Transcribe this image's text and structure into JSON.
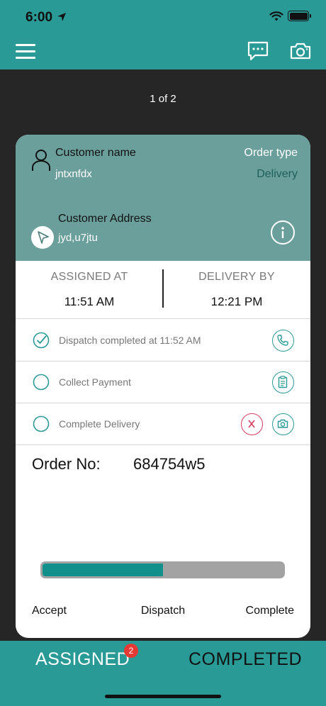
{
  "status_bar": {
    "time": "6:00"
  },
  "pager": "1 of 2",
  "customer": {
    "label": "Customer name",
    "name": "jntxnfdx"
  },
  "order_type": {
    "label": "Order type",
    "value": "Delivery"
  },
  "address": {
    "label": "Customer Address",
    "value": "jyd,u7jtu"
  },
  "times": {
    "assigned_label": "ASSIGNED AT",
    "assigned_value": "11:51 AM",
    "delivery_label": "DELIVERY BY",
    "delivery_value": "12:21 PM"
  },
  "tasks": [
    {
      "label": "Dispatch completed at 11:52 AM",
      "done": true,
      "actions": [
        "phone-icon"
      ]
    },
    {
      "label": "Collect Payment",
      "done": false,
      "actions": [
        "clipboard-icon"
      ]
    },
    {
      "label": "Complete Delivery",
      "done": false,
      "actions": [
        "close-icon",
        "camera-icon"
      ]
    }
  ],
  "order": {
    "label": "Order No:",
    "value": "684754w5"
  },
  "progress": {
    "fraction": 0.5
  },
  "steps": {
    "accept": "Accept",
    "dispatch": "Dispatch",
    "complete": "Complete"
  },
  "tabs": {
    "assigned": "ASSIGNED",
    "assigned_badge": "2",
    "completed": "COMPLETED"
  },
  "colors": {
    "header": "#2a9a96",
    "card_top": "#6b9f9b",
    "progress_fill": "#11908c",
    "badge": "#e53935"
  }
}
